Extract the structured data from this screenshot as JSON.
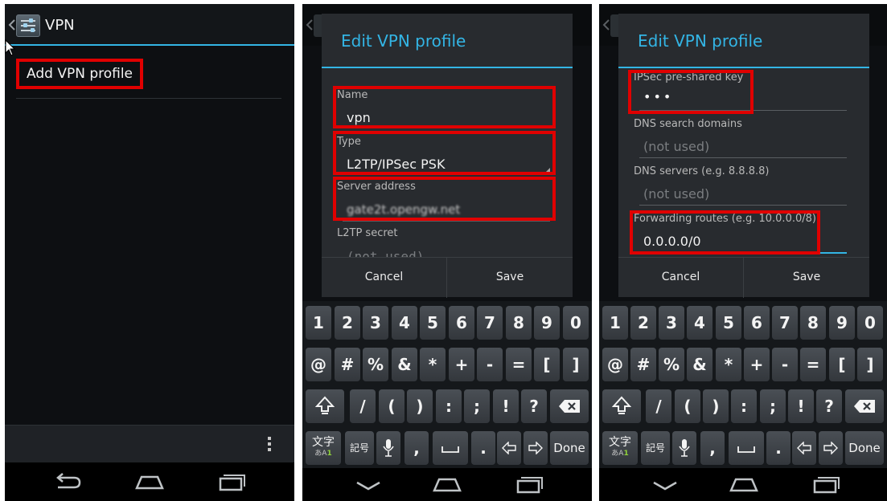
{
  "screen1": {
    "title": "VPN",
    "add_vpn_profile": "Add VPN profile",
    "icons": [
      "back-chevron-icon",
      "settings-icon",
      "mouse-cursor-icon",
      "overflow-menu-icon",
      "nav-back-icon",
      "nav-home-icon",
      "nav-recents-icon"
    ]
  },
  "screen2": {
    "dialog_title": "Edit VPN profile",
    "fields": {
      "name_label": "Name",
      "name_value": "vpn",
      "type_label": "Type",
      "type_value": "L2TP/IPSec PSK",
      "server_label": "Server address",
      "server_value": "gate2t.opengw.net",
      "l2tp_label": "L2TP secret",
      "l2tp_placeholder": "(not used)"
    },
    "cancel": "Cancel",
    "save": "Save"
  },
  "screen3": {
    "dialog_title": "Edit VPN profile",
    "fields": {
      "psk_label": "IPSec pre-shared key",
      "psk_value": "•••",
      "dns_search_label": "DNS search domains",
      "dns_search_placeholder": "(not used)",
      "dns_servers_label": "DNS servers (e.g. 8.8.8.8)",
      "dns_servers_placeholder": "(not used)",
      "routes_label": "Forwarding routes (e.g. 10.0.0.0/8)",
      "routes_value": "0.0.0.0/0"
    },
    "cancel": "Cancel",
    "save": "Save"
  },
  "keyboard": {
    "row1": [
      "1",
      "2",
      "3",
      "4",
      "5",
      "6",
      "7",
      "8",
      "9",
      "0"
    ],
    "row2": [
      "@",
      "#",
      "%",
      "&",
      "*",
      "+",
      "-",
      "=",
      "[",
      "]"
    ],
    "row3": [
      "/",
      "(",
      ")",
      ":",
      ";",
      "!",
      "?"
    ],
    "row4": {
      "lang_top": "文字",
      "lang_bottom": "あA",
      "lang_badge": "1",
      "symbols": "記号",
      "comma": ",",
      "period": ".",
      "done": "Done"
    },
    "icons": [
      "shift-icon",
      "backspace-icon",
      "mic-icon",
      "space-icon",
      "arrow-left-icon",
      "arrow-right-icon"
    ]
  },
  "colors": {
    "accent": "#33b5e5",
    "highlight_box": "#e00000",
    "background": "#0d0f12",
    "dialog": "#282b2f"
  }
}
